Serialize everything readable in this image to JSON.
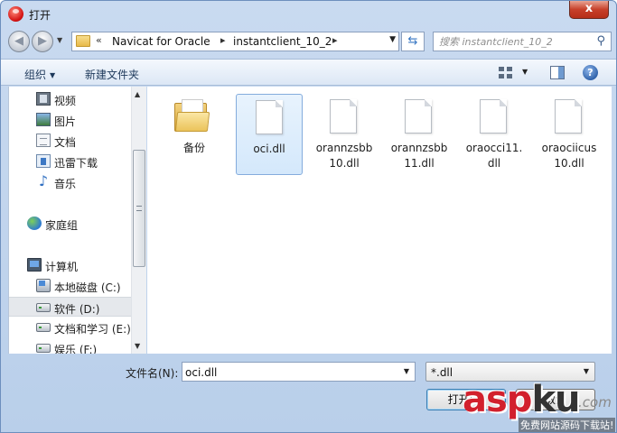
{
  "window": {
    "title": "打开",
    "close_glyph": "x"
  },
  "navigation": {
    "back_icon": "back-arrow-icon",
    "forward_icon": "forward-arrow-icon",
    "breadcrumb": {
      "prefix": "«",
      "items": [
        "Navicat for Oracle",
        "instantclient_10_2"
      ]
    },
    "search_placeholder": "搜索 instantclient_10_2"
  },
  "toolbar": {
    "organize_label": "组织",
    "new_folder_label": "新建文件夹",
    "help_glyph": "?"
  },
  "sidebar": {
    "items": [
      {
        "label": "视频",
        "icon": "video-library-icon"
      },
      {
        "label": "图片",
        "icon": "picture-library-icon"
      },
      {
        "label": "文档",
        "icon": "document-library-icon"
      },
      {
        "label": "迅雷下载",
        "icon": "xunlei-download-icon"
      },
      {
        "label": "音乐",
        "icon": "music-library-icon"
      },
      {
        "label": "家庭组",
        "icon": "homegroup-icon"
      },
      {
        "label": "计算机",
        "icon": "computer-icon"
      },
      {
        "label": "本地磁盘 (C:)",
        "icon": "system-drive-icon"
      },
      {
        "label": "软件 (D:)",
        "icon": "drive-icon",
        "selected": true
      },
      {
        "label": "文档和学习 (E:)",
        "icon": "drive-icon"
      },
      {
        "label": "娱乐 (F:)",
        "icon": "drive-icon"
      }
    ]
  },
  "files": [
    {
      "name": "备份",
      "type": "folder"
    },
    {
      "name": "oci.dll",
      "type": "file",
      "selected": true
    },
    {
      "name": "orannzsbb10.dll",
      "line1": "orannzsbb",
      "line2": "10.dll",
      "type": "file"
    },
    {
      "name": "orannzsbb11.dll",
      "line1": "orannzsbb",
      "line2": "11.dll",
      "type": "file"
    },
    {
      "name": "oraocci11.dll",
      "line1": "oraocci11.",
      "line2": "dll",
      "type": "file"
    },
    {
      "name": "oraociicus10.dll",
      "line1": "oraociicus",
      "line2": "10.dll",
      "type": "file"
    }
  ],
  "footer": {
    "filename_label": "文件名(N):",
    "filename_value": "oci.dll",
    "filetype_value": "*.dll",
    "open_label": "打开(",
    "cancel_label": "取消"
  },
  "watermark": {
    "text_red": "asp",
    "text_dark": "ku",
    "suffix": ".com",
    "subtitle": "免费网站源码下载站!"
  },
  "colors": {
    "selection": "#d4e8fb",
    "accent": "#3877c3",
    "watermark": "#d2202d"
  }
}
